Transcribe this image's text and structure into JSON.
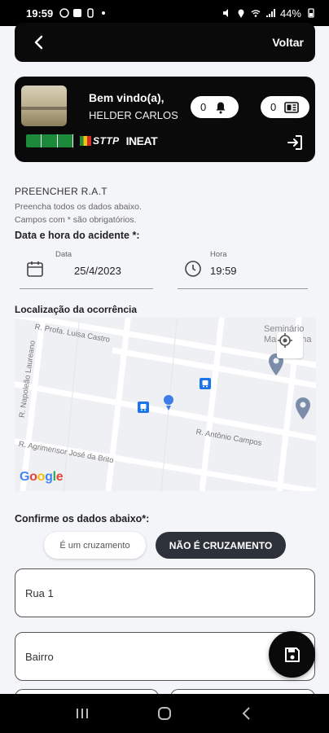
{
  "status_bar": {
    "time": "19:59",
    "battery": "44%"
  },
  "top_bar": {
    "back_label": "Voltar"
  },
  "profile": {
    "welcome": "Bem vindo(a),",
    "name": "HELDER CARLOS",
    "notifications_count": "0",
    "messages_count": "0",
    "logos": {
      "sttp": "STTP",
      "ineat": "INEAT"
    }
  },
  "form": {
    "section_title": "PREENCHER R.A.T",
    "hint_line1": "Preencha todos os dados abaixo.",
    "hint_line2": "Campos com * são obrigatórios.",
    "datetime_label": "Data e hora do acidente *:",
    "date": {
      "label": "Data",
      "value": "25/4/2023"
    },
    "time": {
      "label": "Hora",
      "value": "19:59"
    },
    "location_label": "Localização da ocorrência",
    "confirm_label": "Confirme os dados abaixo*:",
    "chip_crossing": "É um cruzamento",
    "chip_not_crossing": "NÃO É CRUZAMENTO",
    "street_value": "Rua 1",
    "bairro_placeholder": "Bairro"
  },
  "map": {
    "streets": {
      "profa": "R. Profa. Luisa Castro",
      "napoleao": "R. Napoleão Laureano",
      "antonio": "R. Antônio Campos",
      "agrimensor": "R. Agrimensor José da Brito"
    },
    "poi": "Seminário Maria Viana",
    "attribution": "Google"
  },
  "colors": {
    "dark": "#0a0a0a",
    "chip_active": "#2c313a",
    "map_pin": "#3d7de8",
    "transit": "#1a73e8"
  }
}
